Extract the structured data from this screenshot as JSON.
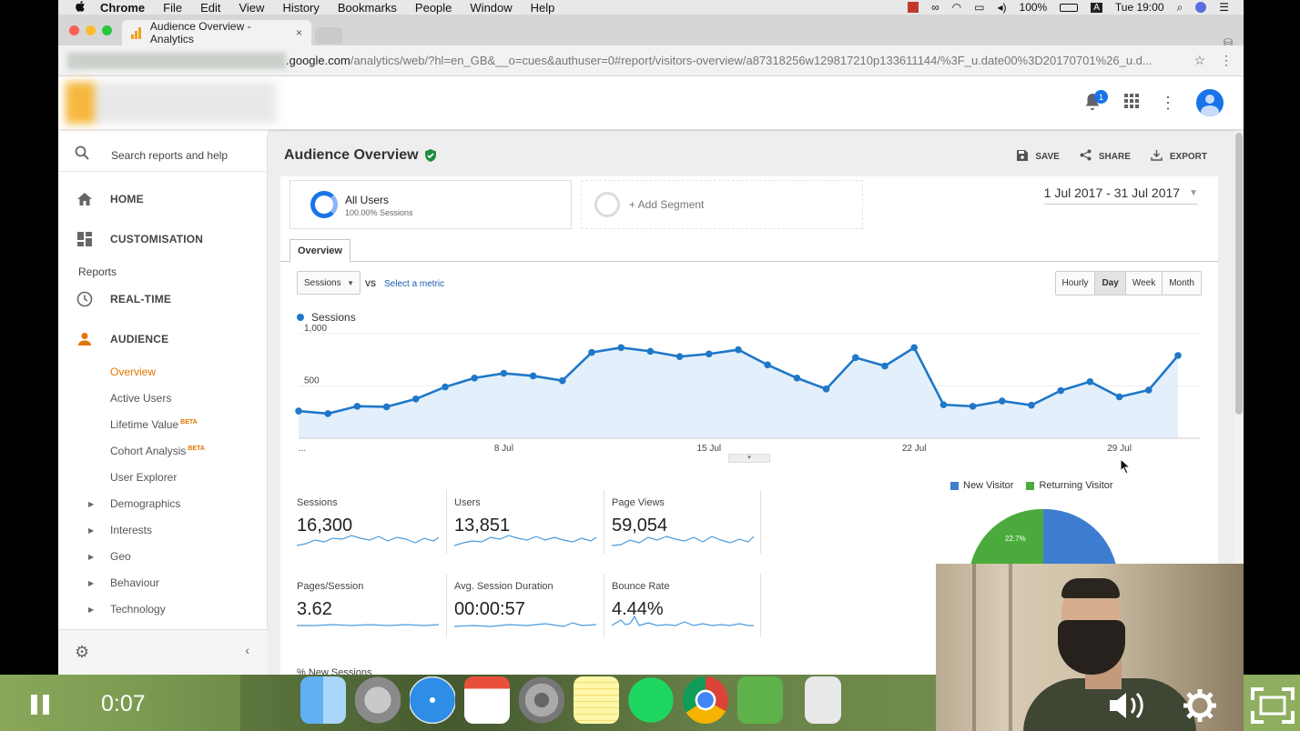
{
  "menubar": {
    "app": "Chrome",
    "items": [
      "File",
      "Edit",
      "View",
      "History",
      "Bookmarks",
      "People",
      "Window",
      "Help"
    ],
    "battery": "100%",
    "input_badge": "A",
    "clock": "Tue 19:00"
  },
  "browser": {
    "tab_title": "Audience Overview - Analytics",
    "tab_close": "×",
    "url_host": ".google.com",
    "url_rest": "/analytics/web/?hl=en_GB&__o=cues&authuser=0#report/visitors-overview/a87318256w129817210p133611144/%3F_u.date00%3D20170701%26_u.d..."
  },
  "header": {
    "notification_count": "1"
  },
  "sidebar": {
    "search_placeholder": "Search reports and help",
    "home": "HOME",
    "customisation": "CUSTOMISATION",
    "reports_label": "Reports",
    "realtime": "REAL-TIME",
    "audience": "AUDIENCE",
    "sub_items": {
      "overview": "Overview",
      "active_users": "Active Users",
      "lifetime_value": "Lifetime Value",
      "cohort_analysis": "Cohort Analysis",
      "user_explorer": "User Explorer",
      "demographics": "Demographics",
      "interests": "Interests",
      "geo": "Geo",
      "behaviour": "Behaviour",
      "technology": "Technology"
    },
    "beta": "BETA"
  },
  "main": {
    "title": "Audience Overview",
    "actions": {
      "save": "SAVE",
      "share": "SHARE",
      "export": "EXPORT"
    },
    "segment": {
      "name": "All Users",
      "share": "100.00% Sessions",
      "add": "+ Add Segment"
    },
    "date_range": "1 Jul 2017 - 31 Jul 2017",
    "tab": "Overview",
    "metric_select": "Sessions",
    "vs": "VS",
    "select_metric": "Select a metric",
    "granularity": [
      "Hourly",
      "Day",
      "Week",
      "Month"
    ],
    "granularity_selected": "Day",
    "metrics": [
      {
        "label": "Sessions",
        "value": "16,300"
      },
      {
        "label": "Users",
        "value": "13,851"
      },
      {
        "label": "Page Views",
        "value": "59,054"
      },
      {
        "label": "Pages/Session",
        "value": "3.62"
      },
      {
        "label": "Avg. Session Duration",
        "value": "00:00:57"
      },
      {
        "label": "Bounce Rate",
        "value": "4.44%"
      }
    ],
    "cut_label": "% New Sessions",
    "pie": {
      "legend": [
        "New Visitor",
        "Returning Visitor"
      ],
      "colors": [
        "#3d7dd0",
        "#4aab3c"
      ],
      "returning_label": "22.7%"
    }
  },
  "chart_data": {
    "type": "line",
    "series": [
      {
        "name": "Sessions",
        "color": "#1f77c9",
        "values": [
          260,
          235,
          305,
          300,
          375,
          490,
          575,
          620,
          595,
          550,
          820,
          865,
          830,
          780,
          805,
          845,
          700,
          575,
          470,
          770,
          690,
          865,
          320,
          305,
          355,
          315,
          455,
          540,
          395,
          460,
          790
        ]
      }
    ],
    "x": [
      1,
      2,
      3,
      4,
      5,
      6,
      7,
      8,
      9,
      10,
      11,
      12,
      13,
      14,
      15,
      16,
      17,
      18,
      19,
      20,
      21,
      22,
      23,
      24,
      25,
      26,
      27,
      28,
      29,
      30,
      31
    ],
    "xticks": [
      "...",
      "8 Jul",
      "15 Jul",
      "22 Jul",
      "29 Jul"
    ],
    "yticks": [
      "500",
      "1,000"
    ],
    "ylim": [
      0,
      1000
    ],
    "legend_position": "top-left"
  },
  "video": {
    "time": "0:07"
  }
}
